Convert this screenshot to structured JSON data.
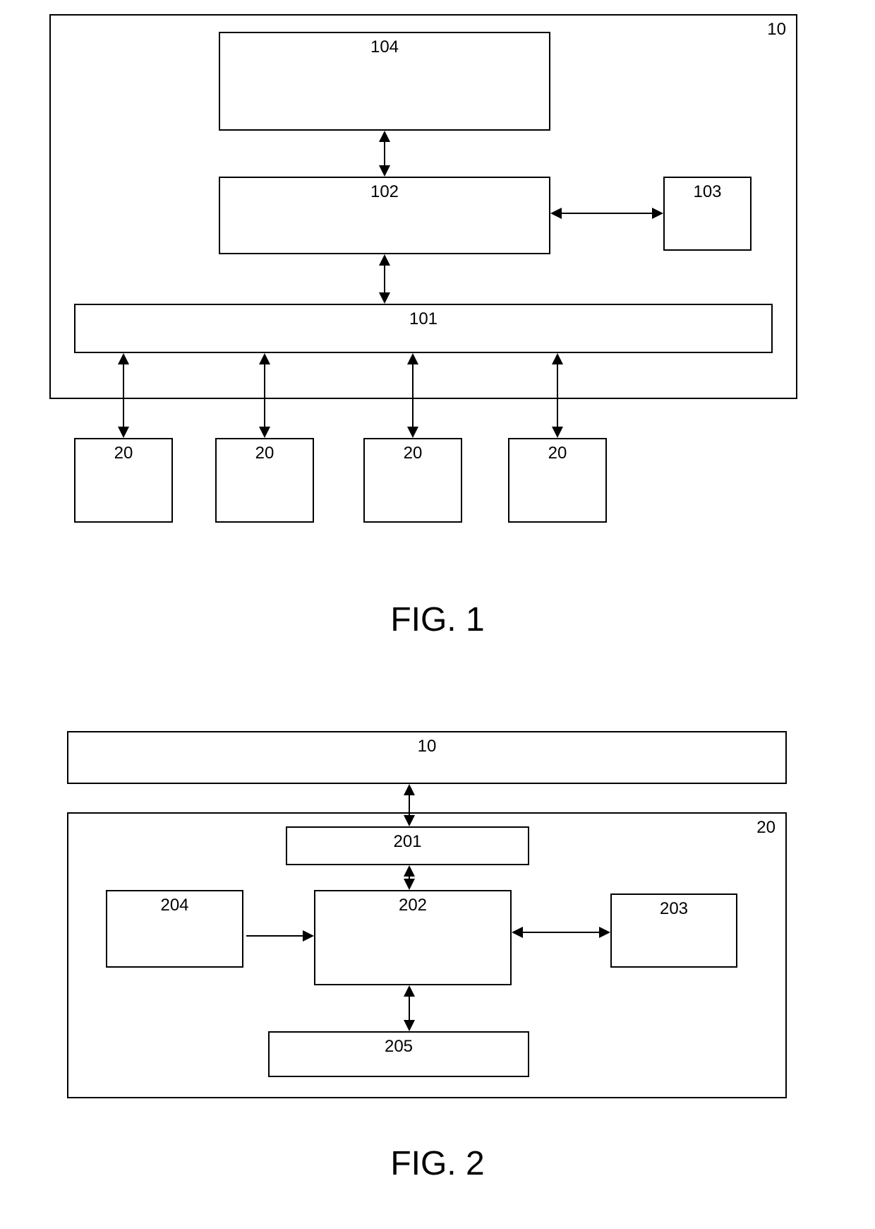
{
  "fig1": {
    "caption": "FIG. 1",
    "outer": "10",
    "block104": "104",
    "block102": "102",
    "block103": "103",
    "block101": "101",
    "sub20_1": "20",
    "sub20_2": "20",
    "sub20_3": "20",
    "sub20_4": "20"
  },
  "fig2": {
    "caption": "FIG. 2",
    "top10": "10",
    "outer": "20",
    "block201": "201",
    "block202": "202",
    "block203": "203",
    "block204": "204",
    "block205": "205"
  }
}
